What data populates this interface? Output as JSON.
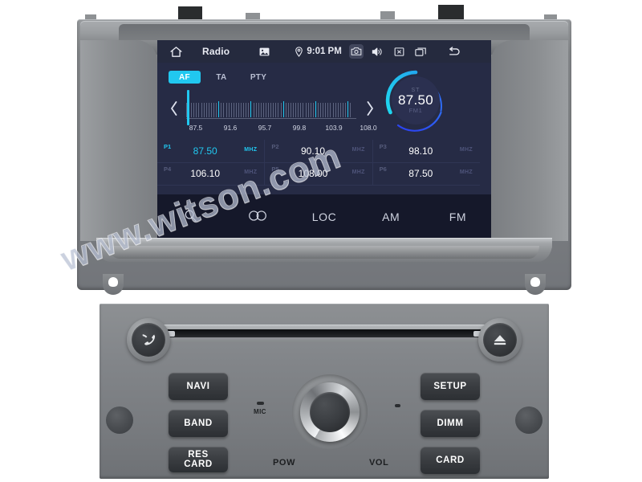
{
  "screen": {
    "statusbar": {
      "home_icon": "home-icon",
      "title": "Radio",
      "image_icon": "image-icon",
      "location_icon": "location-pin-icon",
      "time": "9:01 PM",
      "screenshot_icon": "camera-icon",
      "volume_icon": "speaker-icon",
      "close_icon": "close-box-icon",
      "recents_icon": "recents-icon",
      "back_icon": "back-arrow-icon"
    },
    "rds": [
      {
        "label": "AF",
        "active": true
      },
      {
        "label": "TA",
        "active": false
      },
      {
        "label": "PTY",
        "active": false
      }
    ],
    "tuner": {
      "prev_icon": "chevron-left-icon",
      "next_icon": "chevron-right-icon",
      "scale_labels": [
        "87.5",
        "91.6",
        "95.7",
        "99.8",
        "103.9",
        "108.0"
      ],
      "cursor_frequency": "87.5",
      "range_min": 87.5,
      "range_max": 108.0
    },
    "dial": {
      "stereo": "ST",
      "frequency": "87.50",
      "band": "FM1",
      "accent_start": "#21c8f0",
      "accent_end": "#2b46f0"
    },
    "presets": [
      {
        "no": "P1",
        "freq": "87.50",
        "unit": "MHZ",
        "active": true
      },
      {
        "no": "P2",
        "freq": "90.10",
        "unit": "MHZ",
        "active": false
      },
      {
        "no": "P3",
        "freq": "98.10",
        "unit": "MHZ",
        "active": false
      },
      {
        "no": "P4",
        "freq": "106.10",
        "unit": "MHZ",
        "active": false
      },
      {
        "no": "P5",
        "freq": "108.00",
        "unit": "MHZ",
        "active": false
      },
      {
        "no": "P6",
        "freq": "87.50",
        "unit": "MHZ",
        "active": false
      }
    ],
    "toolbar": [
      {
        "label": "",
        "icon": "search-icon"
      },
      {
        "label": "",
        "icon": "scan-rings-icon"
      },
      {
        "label": "LOC",
        "icon": ""
      },
      {
        "label": "AM",
        "icon": ""
      },
      {
        "label": "FM",
        "icon": ""
      }
    ]
  },
  "hardware": {
    "left_knob_icon": "phone-icon",
    "right_knob_icon": "eject-icon",
    "buttons_left": [
      "NAVI",
      "BAND",
      "RES\nCARD"
    ],
    "buttons_right": [
      "SETUP",
      "DIMM",
      "CARD"
    ],
    "mic_label": "MIC",
    "pow_label": "POW",
    "vol_label": "VOL",
    "disc_slot": "cd-slot"
  },
  "watermark": {
    "text": "www.witson.com"
  }
}
